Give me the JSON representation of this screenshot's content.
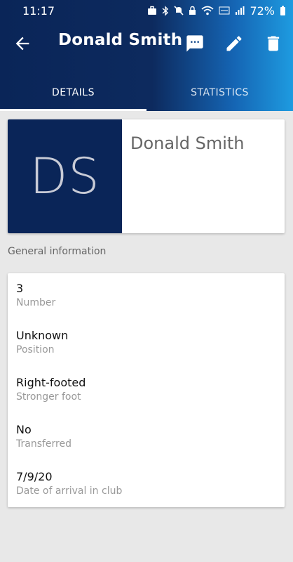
{
  "status_bar": {
    "time": "11:17",
    "battery": "72%"
  },
  "toolbar": {
    "title": "Donald Smith",
    "icons": [
      "back-arrow-icon",
      "message-icon",
      "edit-icon",
      "delete-icon"
    ]
  },
  "tabs": [
    {
      "label": "DETAILS",
      "selected": true
    },
    {
      "label": "STATISTICS",
      "selected": false
    }
  ],
  "profile": {
    "initials": "DS",
    "name": "Donald Smith"
  },
  "general_info": {
    "title": "General information",
    "rows": [
      {
        "value": "3",
        "label": "Number"
      },
      {
        "value": "Unknown",
        "label": "Position"
      },
      {
        "value": "Right-footed",
        "label": "Stronger foot"
      },
      {
        "value": "No",
        "label": "Transferred"
      },
      {
        "value": "7/9/20",
        "label": "Date of arrival in club"
      }
    ]
  },
  "colors": {
    "primary_dark": "#0a2558",
    "accent_blue": "#1e9be0",
    "background": "#e8e8e8"
  }
}
